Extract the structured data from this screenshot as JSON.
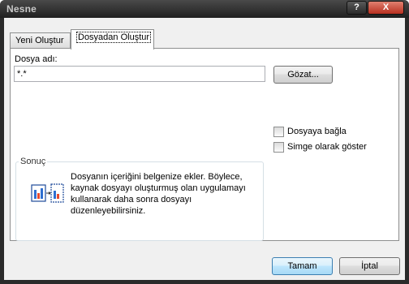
{
  "window": {
    "title": "Nesne",
    "help_label": "?",
    "close_label": "X"
  },
  "tabs": [
    {
      "label": "Yeni Oluştur",
      "selected": false
    },
    {
      "label": "Dosyadan Oluştur",
      "selected": true
    }
  ],
  "file": {
    "label": "Dosya adı:",
    "value": "*.*",
    "browse_label": "Gözat..."
  },
  "options": {
    "link_label": "Dosyaya bağla",
    "link_checked": false,
    "icon_label": "Simge olarak göster",
    "icon_checked": false
  },
  "result": {
    "group_label": "Sonuç",
    "text": "Dosyanın içeriğini belgenize ekler. Böylece, kaynak dosyayı oluşturmuş olan uygulamayı kullanarak daha sonra dosyayı düzenleyebilirsiniz."
  },
  "buttons": {
    "ok_label": "Tamam",
    "cancel_label": "İptal"
  }
}
